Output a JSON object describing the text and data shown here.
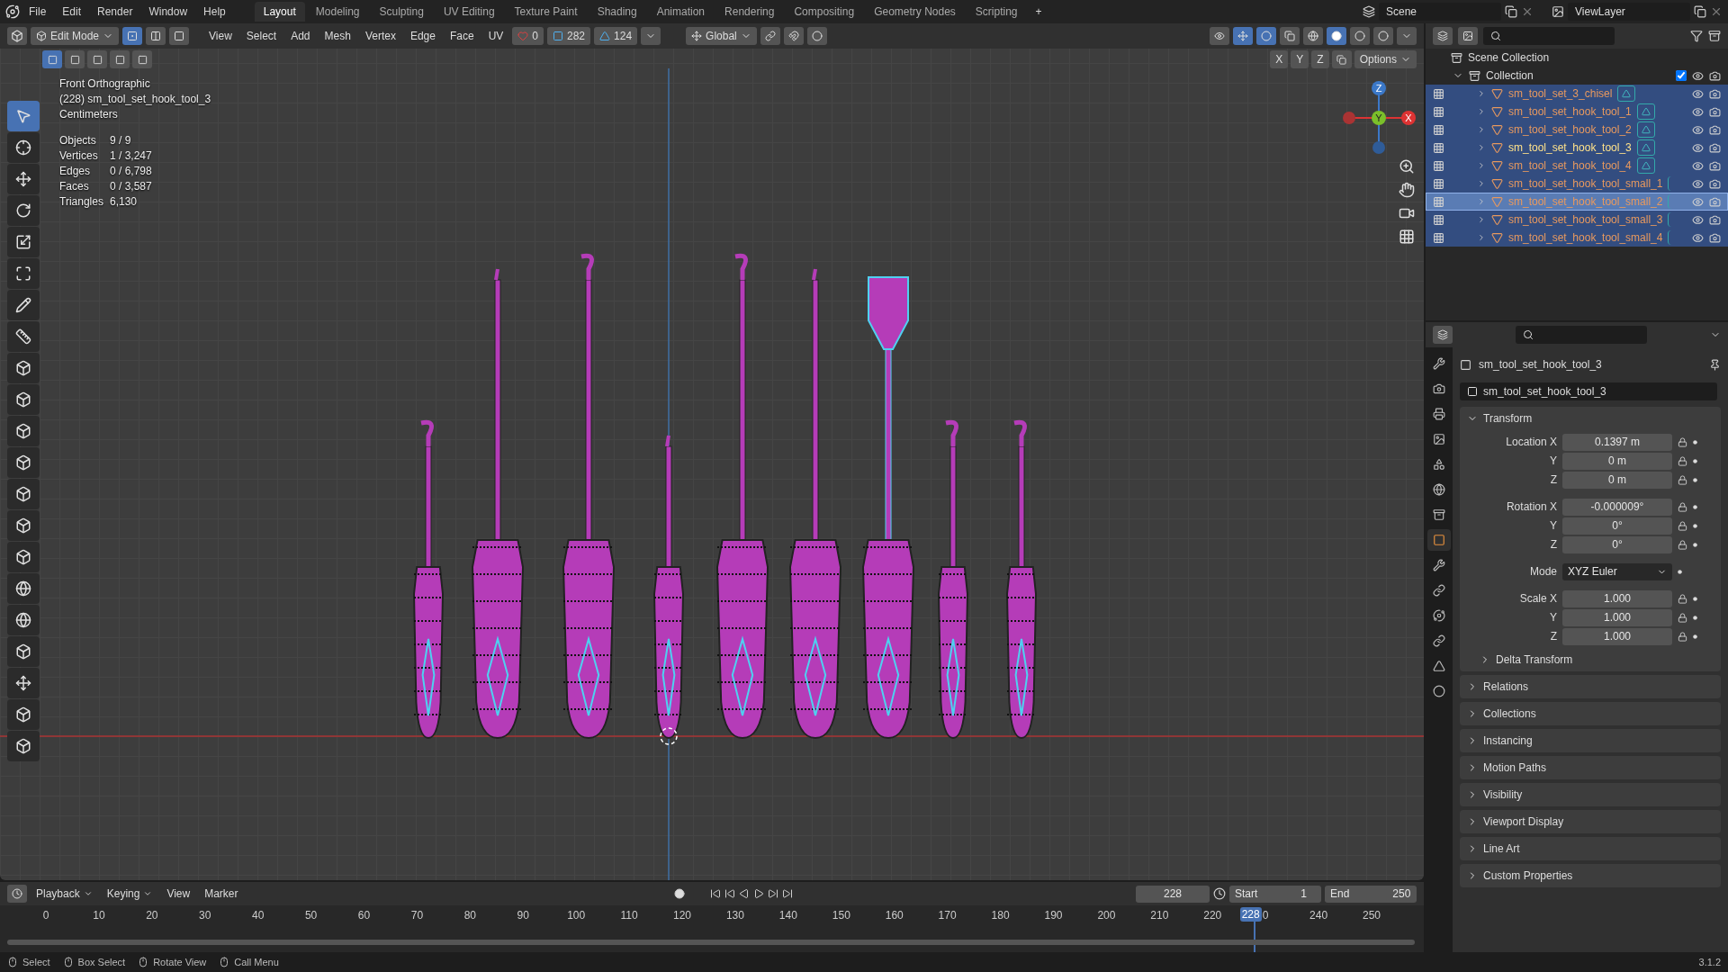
{
  "top_bar": {
    "menus": [
      "File",
      "Edit",
      "Render",
      "Window",
      "Help"
    ],
    "workspaces": [
      {
        "label": "Layout",
        "selected": true
      },
      {
        "label": "Modeling",
        "selected": false
      },
      {
        "label": "Sculpting",
        "selected": false
      },
      {
        "label": "UV Editing",
        "selected": false
      },
      {
        "label": "Texture Paint",
        "selected": false
      },
      {
        "label": "Shading",
        "selected": false
      },
      {
        "label": "Animation",
        "selected": false
      },
      {
        "label": "Rendering",
        "selected": false
      },
      {
        "label": "Compositing",
        "selected": false
      },
      {
        "label": "Geometry Nodes",
        "selected": false
      },
      {
        "label": "Scripting",
        "selected": false
      }
    ],
    "add_tab": "+",
    "scene": "Scene",
    "view_layer": "ViewLayer"
  },
  "viewport": {
    "header": {
      "mode": "Edit Mode",
      "select_modes": [
        {
          "kind": "vertex",
          "selected": true
        },
        {
          "kind": "edge",
          "selected": false
        },
        {
          "kind": "face",
          "selected": false
        }
      ],
      "menus": [
        "View",
        "Select",
        "Add",
        "Mesh",
        "Vertex",
        "Edge",
        "Face",
        "UV"
      ],
      "counters": [
        {
          "kind": "heart",
          "value": "0"
        },
        {
          "kind": "square",
          "value": "282"
        },
        {
          "kind": "vertex",
          "value": "124"
        }
      ],
      "orientation": "Global",
      "axes": [
        "X",
        "Y",
        "Z"
      ],
      "options": "Options"
    },
    "tools": [
      {
        "kind": "select",
        "selected": true
      },
      {
        "kind": "cursor",
        "selected": false
      },
      {
        "kind": "move",
        "selected": false
      },
      {
        "kind": "rotate",
        "selected": false
      },
      {
        "kind": "scale",
        "selected": false
      },
      {
        "kind": "transform",
        "selected": false
      },
      {
        "kind": "annotate",
        "selected": false
      },
      {
        "kind": "measure",
        "selected": false
      },
      {
        "kind": "cube",
        "selected": false
      },
      {
        "kind": "cube",
        "selected": false
      },
      {
        "kind": "cube",
        "selected": false
      },
      {
        "kind": "cube",
        "selected": false
      },
      {
        "kind": "cube",
        "selected": false
      },
      {
        "kind": "cube",
        "selected": false
      },
      {
        "kind": "cube",
        "selected": false
      },
      {
        "kind": "sphere",
        "selected": false
      },
      {
        "kind": "sphere",
        "selected": false
      },
      {
        "kind": "cube",
        "selected": false
      },
      {
        "kind": "move",
        "selected": false
      },
      {
        "kind": "cube",
        "selected": false
      },
      {
        "kind": "cube",
        "selected": false
      }
    ],
    "info": [
      "Front Orthographic",
      "(228) sm_tool_set_hook_tool_3",
      "Centimeters"
    ],
    "stats": [
      {
        "label": "Objects",
        "value": "9 / 9"
      },
      {
        "label": "Vertices",
        "value": "1 / 3,247"
      },
      {
        "label": "Edges",
        "value": "0 / 6,798"
      },
      {
        "label": "Faces",
        "value": "0 / 3,587"
      },
      {
        "label": "Triangles",
        "value": "6,130"
      }
    ],
    "gizmo": {
      "z": "Z",
      "y": "Y",
      "x": "X"
    }
  },
  "outliner": {
    "root": "Scene Collection",
    "collection": {
      "name": "Collection",
      "expanded": true,
      "checked": true
    },
    "items": [
      {
        "name": "sm_tool_set_3_chisel",
        "selected": true,
        "active": false,
        "hovered": false,
        "mesh_badge": true
      },
      {
        "name": "sm_tool_set_hook_tool_1",
        "selected": true,
        "active": false,
        "hovered": false,
        "mesh_badge": true
      },
      {
        "name": "sm_tool_set_hook_tool_2",
        "selected": true,
        "active": false,
        "hovered": false,
        "mesh_badge": true
      },
      {
        "name": "sm_tool_set_hook_tool_3",
        "selected": true,
        "active": true,
        "hovered": false,
        "mesh_badge": true
      },
      {
        "name": "sm_tool_set_hook_tool_4",
        "selected": true,
        "active": false,
        "hovered": false,
        "mesh_badge": true
      },
      {
        "name": "sm_tool_set_hook_tool_small_1",
        "selected": true,
        "active": false,
        "hovered": false,
        "mesh_badge": false
      },
      {
        "name": "sm_tool_set_hook_tool_small_2",
        "selected": true,
        "active": false,
        "hovered": true,
        "mesh_badge": false
      },
      {
        "name": "sm_tool_set_hook_tool_small_3",
        "selected": true,
        "active": false,
        "hovered": false,
        "mesh_badge": false
      },
      {
        "name": "sm_tool_set_hook_tool_small_4",
        "selected": true,
        "active": false,
        "hovered": false,
        "mesh_badge": false
      }
    ]
  },
  "properties": {
    "tabs": [
      {
        "kind": "tool",
        "selected": false
      },
      {
        "kind": "render",
        "selected": false
      },
      {
        "kind": "output",
        "selected": false
      },
      {
        "kind": "view_layer",
        "selected": false
      },
      {
        "kind": "scene",
        "selected": false
      },
      {
        "kind": "world",
        "selected": false
      },
      {
        "kind": "collection",
        "selected": false
      },
      {
        "kind": "object",
        "selected": true
      },
      {
        "kind": "modifier",
        "selected": false
      },
      {
        "kind": "particles",
        "selected": false
      },
      {
        "kind": "physics",
        "selected": false
      },
      {
        "kind": "constraint",
        "selected": false
      },
      {
        "kind": "data",
        "selected": false
      },
      {
        "kind": "material",
        "selected": false
      }
    ],
    "object_name": "sm_tool_set_hook_tool_3",
    "datablock": "sm_tool_set_hook_tool_3",
    "transform": {
      "title": "Transform",
      "expanded": true,
      "groups": [
        [
          {
            "label": "Location X",
            "value": "0.1397 m",
            "kind": "number"
          },
          {
            "label": "Y",
            "value": "0 m",
            "kind": "number"
          },
          {
            "label": "Z",
            "value": "0 m",
            "kind": "number"
          }
        ],
        [
          {
            "label": "Rotation X",
            "value": "-0.000009°",
            "kind": "number"
          },
          {
            "label": "Y",
            "value": "0°",
            "kind": "number"
          },
          {
            "label": "Z",
            "value": "0°",
            "kind": "number"
          }
        ],
        [
          {
            "label": "Mode",
            "value": "XYZ Euler",
            "kind": "dropdown"
          }
        ],
        [
          {
            "label": "Scale X",
            "value": "1.000",
            "kind": "number"
          },
          {
            "label": "Y",
            "value": "1.000",
            "kind": "number"
          },
          {
            "label": "Z",
            "value": "1.000",
            "kind": "number"
          }
        ]
      ],
      "subpanel": "Delta Transform"
    },
    "panels": [
      "Relations",
      "Collections",
      "Instancing",
      "Motion Paths",
      "Visibility",
      "Viewport Display",
      "Line Art",
      "Custom Properties"
    ]
  },
  "timeline": {
    "menus": [
      "Playback",
      "Keying",
      "View",
      "Marker"
    ],
    "current_frame": "228",
    "start_label": "Start",
    "start": "1",
    "end_label": "End",
    "end": "250",
    "playhead": "228",
    "ticks": [
      "0",
      "10",
      "20",
      "30",
      "40",
      "50",
      "60",
      "70",
      "80",
      "90",
      "100",
      "110",
      "120",
      "130",
      "140",
      "150",
      "160",
      "170",
      "180",
      "190",
      "200",
      "210",
      "220",
      "0",
      "240",
      "250"
    ]
  },
  "status_bar": {
    "hints": [
      "Select",
      "Box Select",
      "Rotate View",
      "Call Menu"
    ],
    "version": "3.1.2"
  }
}
